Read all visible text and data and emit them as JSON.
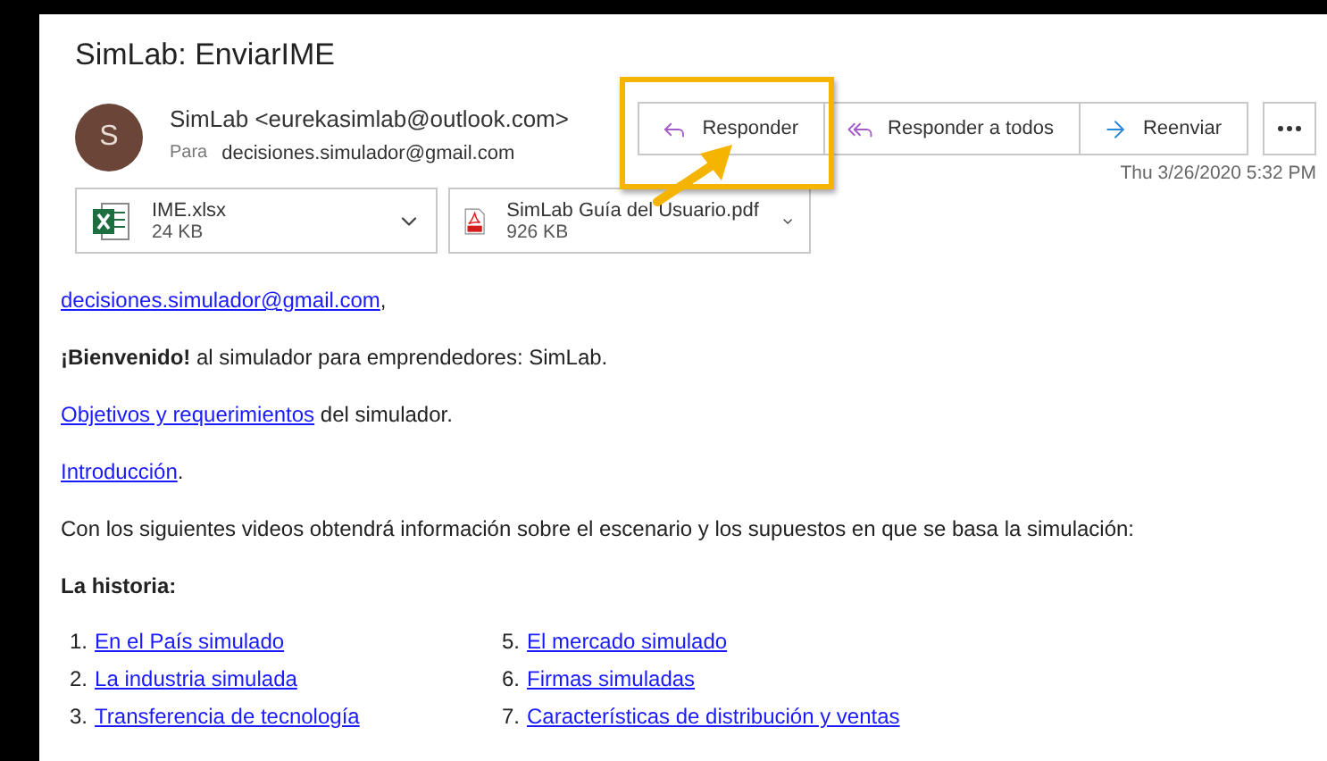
{
  "message": {
    "subject": "SimLab: EnviarIME",
    "avatar_initial": "S",
    "sender": "SimLab <eurekasimlab@outlook.com>",
    "to_label": "Para",
    "to": "decisiones.simulador@gmail.com",
    "date": "Thu 3/26/2020 5:32 PM"
  },
  "actions": [
    {
      "label": "Responder",
      "kind": "reply",
      "highlighted": true
    },
    {
      "label": "Responder a todos",
      "kind": "reply_all",
      "highlighted": false
    },
    {
      "label": "Reenviar",
      "kind": "forward",
      "highlighted": false
    }
  ],
  "attachments": [
    {
      "name": "IME.xlsx",
      "size": "24 KB",
      "kind": "excel"
    },
    {
      "name": "SimLab Guía del Usuario.pdf",
      "size": "926 KB",
      "kind": "pdf"
    }
  ],
  "body": [
    {
      "kind": "link",
      "link": "decisiones.simulador@gmail.com",
      "after": ","
    },
    {
      "kind": "text",
      "text": "**¡Bienvenido!** al simulador para emprendedores: SimLab."
    },
    {
      "kind": "link",
      "link": "Objetivos y requerimientos",
      "after": " del simulador."
    },
    {
      "kind": "link",
      "link": "Introducción",
      "after": "."
    },
    {
      "kind": "text",
      "text": "Con los siguientes videos obtendrá información sobre el escenario y los supuestos en que se basa la simulación:"
    },
    {
      "kind": "heading",
      "text": "La historia:"
    }
  ],
  "videos": [
    [
      {
        "number": "1.",
        "title": "En el País simulado"
      },
      {
        "number": "2.",
        "title": "La industria simulada"
      },
      {
        "number": "3.",
        "title": "Transferencia de tecnología"
      }
    ],
    [
      {
        "number": "5.",
        "title": "El mercado simulado"
      },
      {
        "number": "6.",
        "title": "Firmas simuladas"
      },
      {
        "number": "7.",
        "title": "Características de distribución y ventas"
      }
    ]
  ]
}
